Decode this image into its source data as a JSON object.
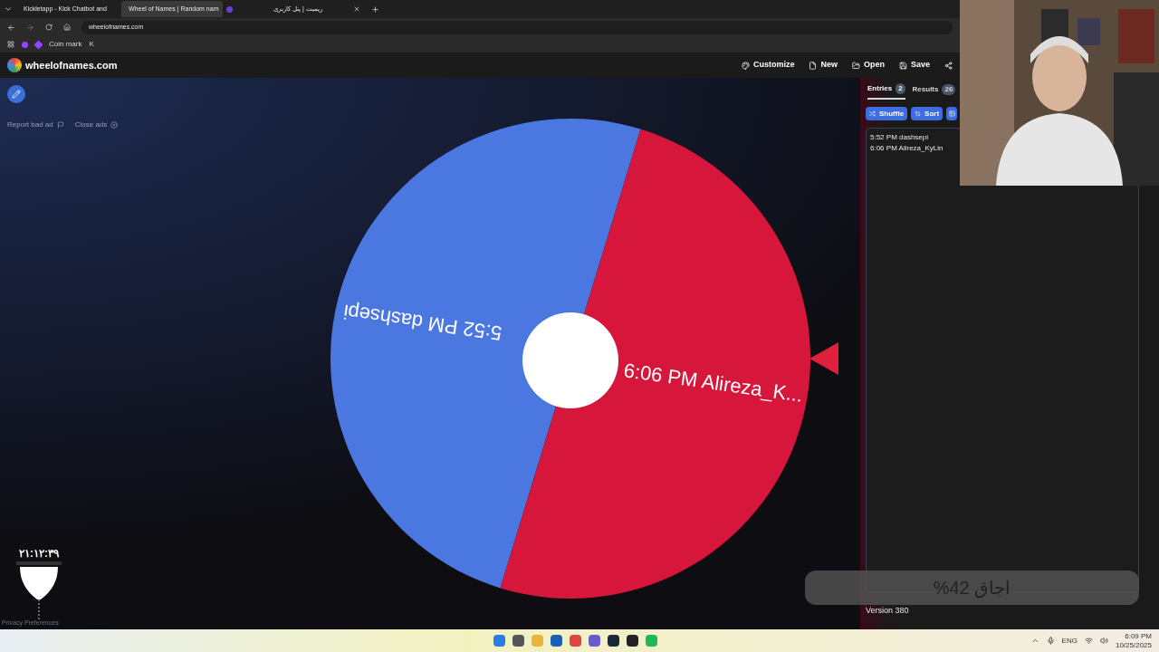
{
  "browser": {
    "tabs": [
      {
        "kind": "full",
        "title": "Kickletapp - Kick Chatbot and",
        "selected": false
      },
      {
        "kind": "full",
        "title": "Wheel of Names | Random nam",
        "selected": true
      },
      {
        "kind": "icon",
        "selected": false
      },
      {
        "kind": "full",
        "title": "ریمیت | پنل کاربری",
        "selected": false
      }
    ],
    "address": "wheelofnames.com",
    "bookmarks": [
      "Coin mark",
      "K"
    ]
  },
  "header": {
    "site_name": "wheelofnames.com",
    "menu": [
      "Customize",
      "New",
      "Open",
      "Save"
    ]
  },
  "ad_links": [
    "Report bad ad",
    "Close ads"
  ],
  "wheel": {
    "segments": [
      {
        "label": "5:52 PM dashsepi",
        "color": "#4a78e0"
      },
      {
        "label": "6:06 PM Alireza_K...",
        "color": "#d6163a"
      }
    ]
  },
  "panel": {
    "tabs": [
      {
        "label": "Entries",
        "count": "2",
        "selected": true
      },
      {
        "label": "Results",
        "count": "26",
        "selected": false
      }
    ],
    "buttons": [
      "Shuffle",
      "Sort"
    ],
    "entries": [
      "5:52 PM dashsepi",
      "6:06 PM Alireza_KyLin"
    ],
    "version": "Version 380"
  },
  "overlay": {
    "timer": "۲۱:۱۲:۳۹",
    "goal": "اجاق 42%",
    "privacy": "Privacy Preferences"
  },
  "taskbar": {
    "language": "ENG",
    "time": "6:09 PM",
    "date": "10/25/2025"
  }
}
